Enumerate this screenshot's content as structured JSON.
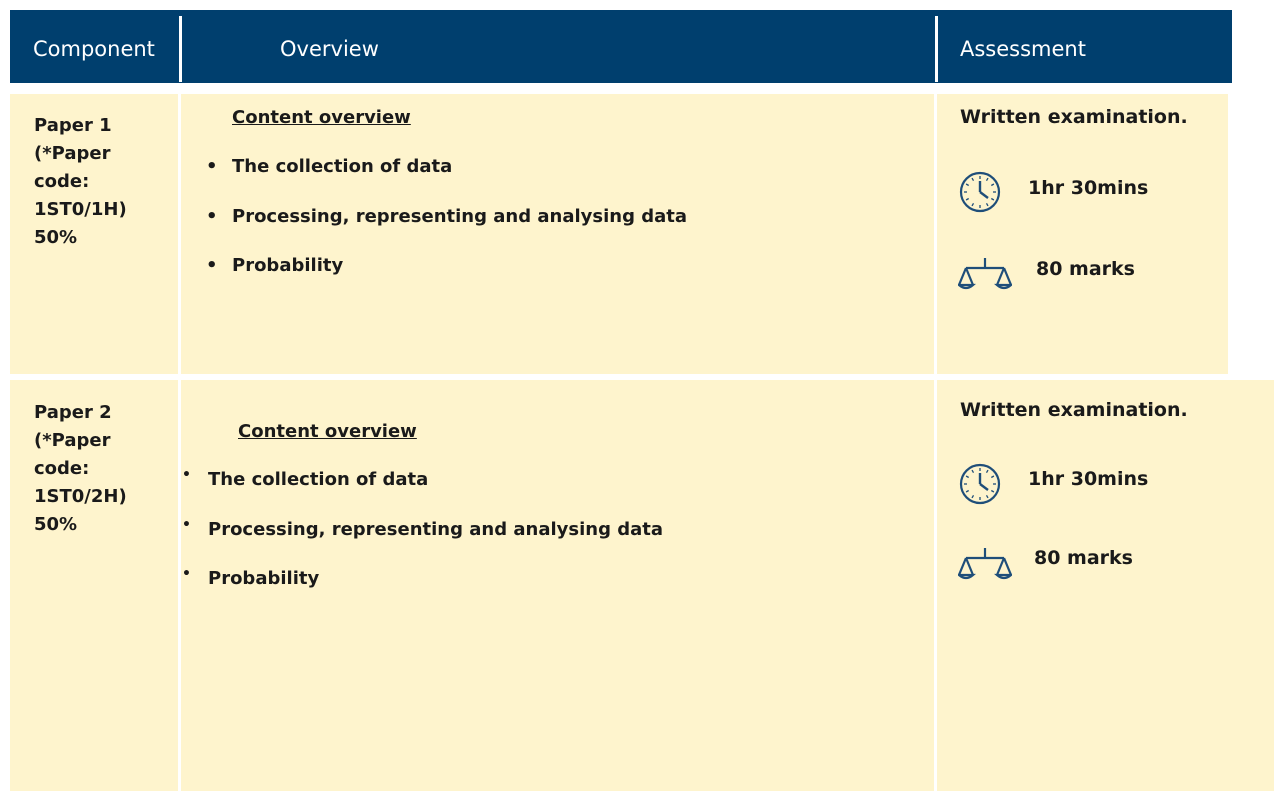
{
  "header": {
    "component": "Component",
    "overview": "Overview",
    "assessment": "Assessment"
  },
  "rows": [
    {
      "component": "Paper 1\n(*Paper\ncode:\n1ST0/1H)\n50%",
      "content_heading": "Content overview",
      "bullets": [
        "The collection of data",
        "Processing, representing and analysing data",
        "Probability"
      ],
      "assessment_type": "Written examination.",
      "duration": "1hr 30mins",
      "marks": "80 marks",
      "duration_icon": "clock-icon",
      "marks_icon": "scales-icon"
    },
    {
      "component": "Paper 2\n(*Paper\ncode:\n1ST0/2H)\n50%",
      "content_heading": "Content overview",
      "bullets": [
        "The collection of data",
        "Processing, representing and analysing data",
        "Probability"
      ],
      "assessment_type": "Written examination.",
      "duration": "1hr 30mins",
      "marks": "80 marks",
      "duration_icon": "clock-icon",
      "marks_icon": "scales-icon"
    }
  ],
  "colors": {
    "header_bg": "#003f6e",
    "row_bg": "#fef4cd",
    "icon_color": "#1f4e79"
  }
}
